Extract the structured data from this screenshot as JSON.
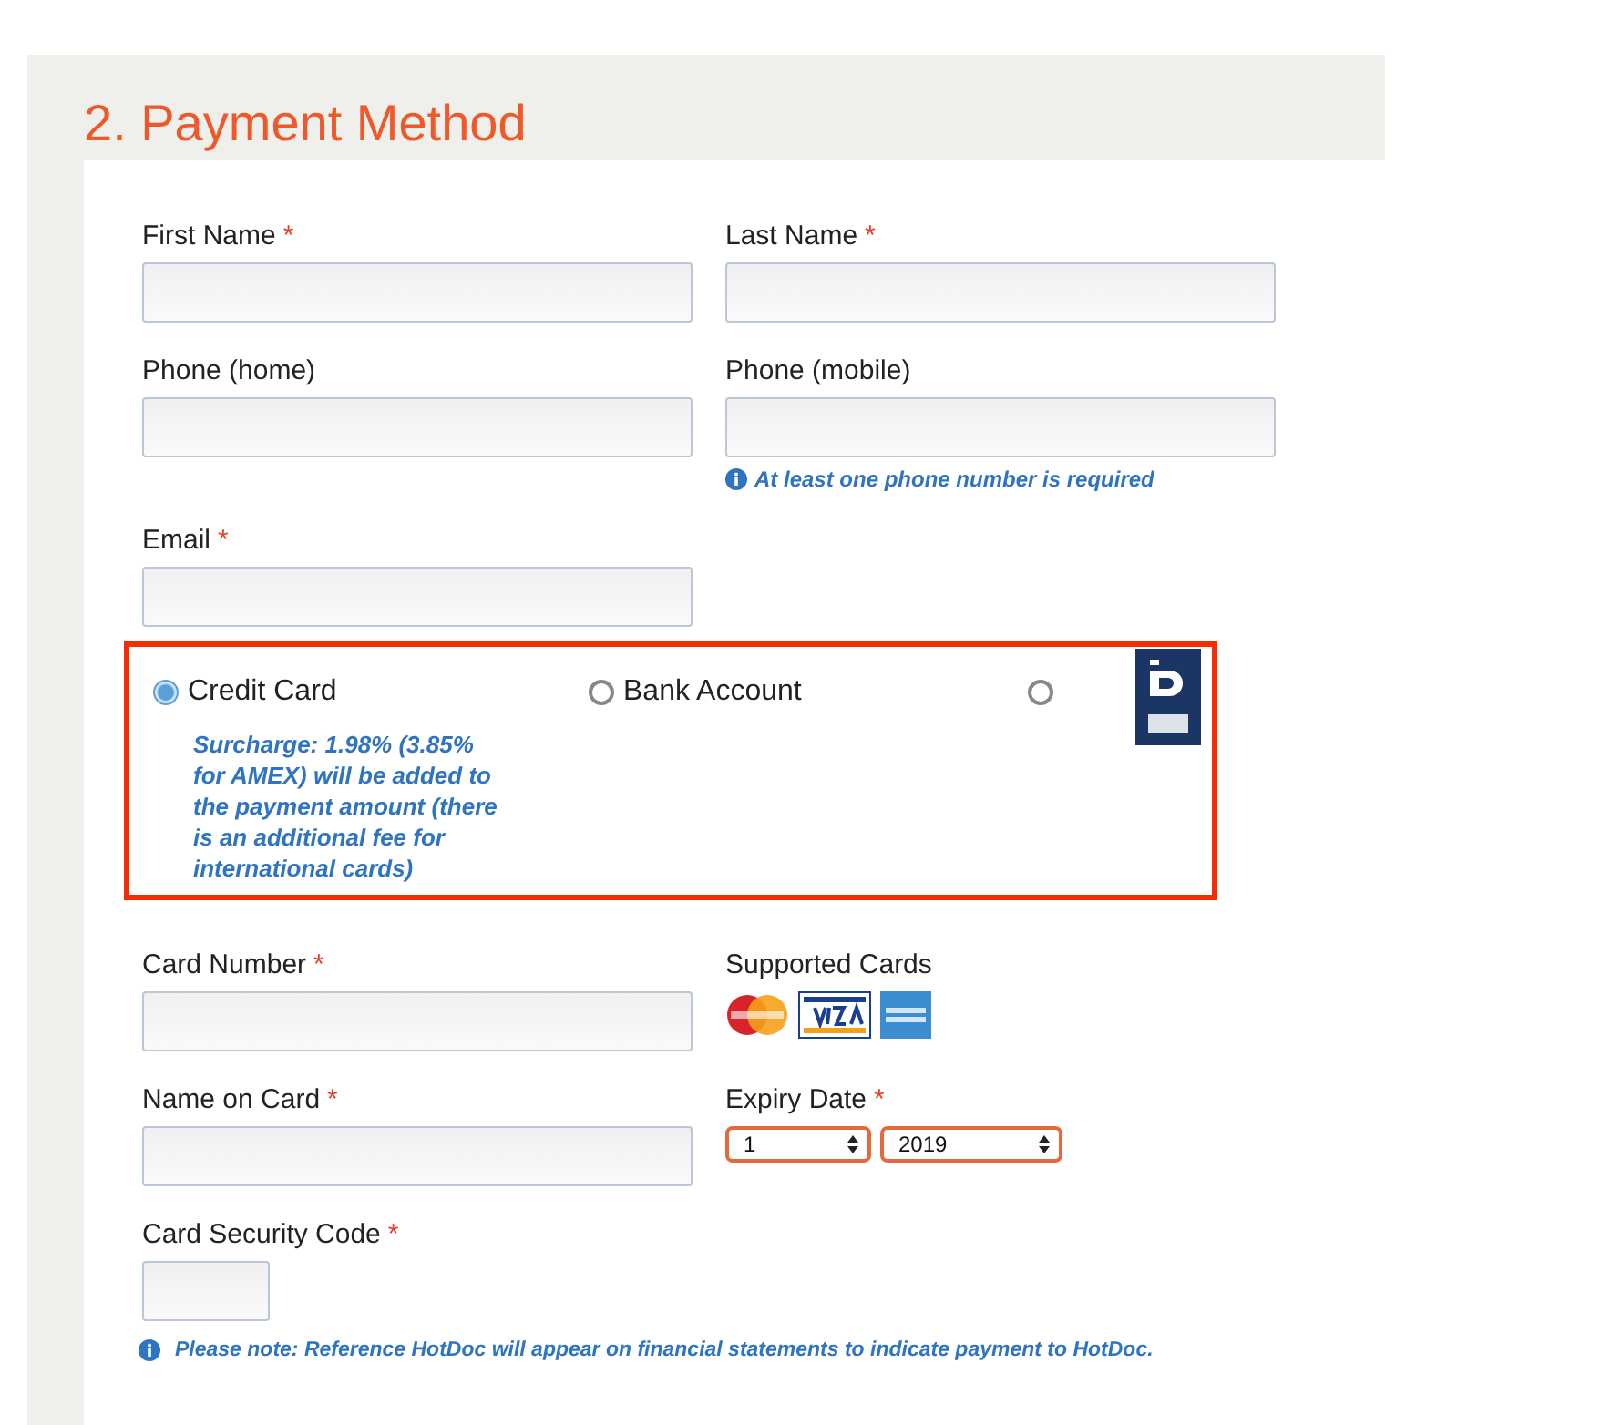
{
  "title": "2. Payment Method",
  "contact_rows": [
    [
      {
        "kind": "input",
        "label": "First Name",
        "mark": "*"
      },
      {
        "kind": "input",
        "label": "Last Name",
        "mark": "*"
      }
    ],
    [
      {
        "kind": "input",
        "label": "Phone (home)"
      },
      {
        "kind": "input",
        "label": "Phone (mobile)",
        "hint": "At least one phone number is required"
      }
    ],
    [
      {
        "kind": "input",
        "label": "Email",
        "mark": "*"
      }
    ]
  ],
  "payment_options": [
    {
      "kind": "text",
      "label": "Credit Card",
      "selected": true,
      "note": "Surcharge: 1.98% (3.85% for AMEX) will be added to the payment amount (there is an additional fee for international cards)"
    },
    {
      "kind": "text",
      "label": "Bank Account",
      "selected": false
    },
    {
      "kind": "bpay-logo",
      "selected": false
    }
  ],
  "card_rows": [
    [
      {
        "kind": "input",
        "label": "Card Number",
        "mark": "*"
      },
      {
        "kind": "cards",
        "label": "Supported Cards",
        "cards": [
          {
            "kind": "mastercard"
          },
          {
            "kind": "visa"
          },
          {
            "kind": "amex"
          }
        ]
      }
    ],
    [
      {
        "kind": "input",
        "label": "Name on Card",
        "mark": "*"
      },
      {
        "kind": "selects",
        "label": "Expiry Date",
        "mark": "*",
        "selects": [
          {
            "value": "1"
          },
          {
            "value": "2019"
          }
        ]
      }
    ],
    [
      {
        "kind": "code-input",
        "label": "Card Security Code",
        "mark": "*"
      }
    ]
  ],
  "note": "Please note: Reference HotDoc will appear on financial statements to indicate payment to HotDoc."
}
